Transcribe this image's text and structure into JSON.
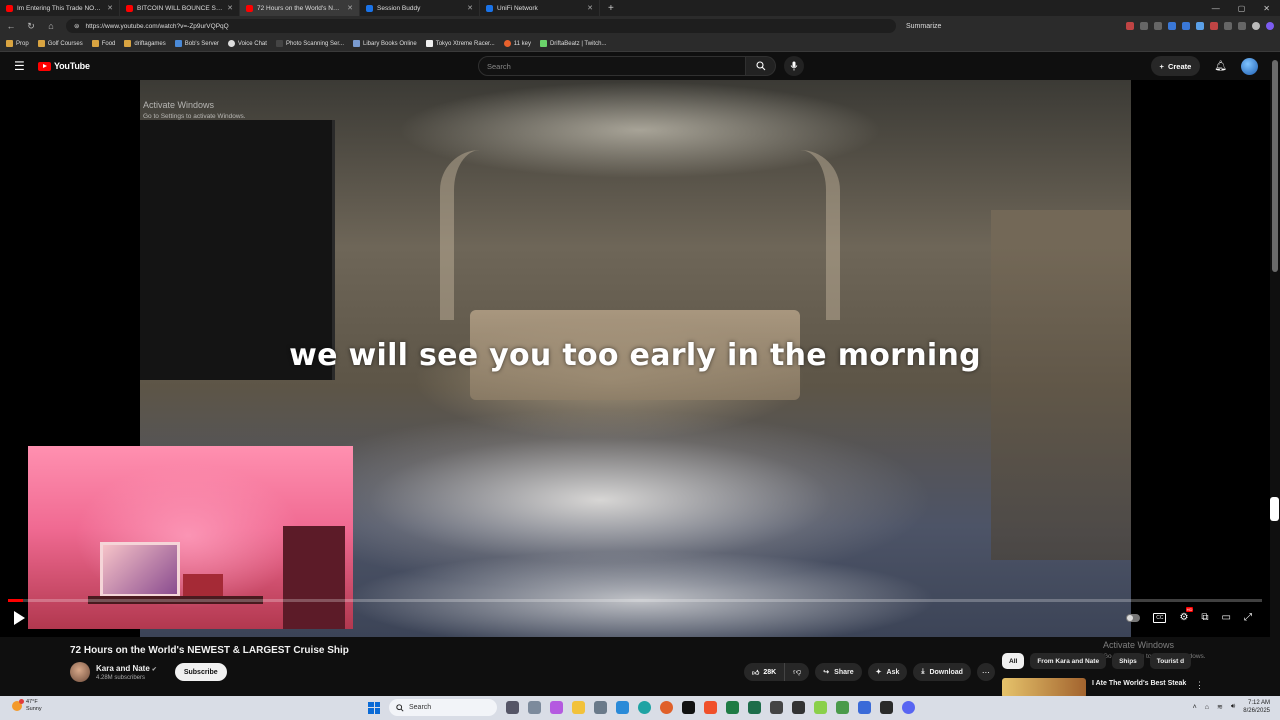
{
  "browser": {
    "tabs": [
      {
        "title": "Im Entering This Trade NOW - ",
        "color": "#ff0000",
        "active": false
      },
      {
        "title": "BITCOIN WILL BOUNCE SOON AF",
        "color": "#ff0000",
        "active": false
      },
      {
        "title": "72 Hours on the World's NEWEST",
        "color": "#ff0000",
        "active": true
      },
      {
        "title": "Session Buddy",
        "color": "#1a73e8",
        "active": false
      },
      {
        "title": "UniFi Network",
        "color": "#1a73e8",
        "active": false
      }
    ],
    "url": "https://www.youtube.com/watch?v=-Zp9urVQPqQ",
    "summarize_label": "Summarize",
    "bookmarks": [
      "Prop",
      "Golf Courses",
      "Food",
      "driftagames",
      "Bob's Server",
      "Voice Chat",
      "Photo Scanning Ser...",
      "Libary Books Online",
      "Tokyo Xtreme Racer...",
      "11 key",
      "DriftaBeatz | Twitch..."
    ]
  },
  "header": {
    "logo_text": "YouTube",
    "search_placeholder": "Search",
    "create_label": "Create"
  },
  "player": {
    "caption": "we will see you too early in the morning",
    "progress": 0.012,
    "watermark_title": "Activate Windows",
    "watermark_sub": "Go to Settings to activate Windows."
  },
  "video": {
    "title": "72 Hours on the World's NEWEST & LARGEST Cruise Ship",
    "channel": "Kara and Nate",
    "subscribers": "4.28M subscribers",
    "subscribe_label": "Subscribe",
    "likes": "28K",
    "share_label": "Share",
    "ask_label": "Ask",
    "download_label": "Download"
  },
  "sidebar": {
    "chips": [
      {
        "label": "All",
        "active": true
      },
      {
        "label": "From Kara and Nate",
        "active": false
      },
      {
        "label": "Ships",
        "active": false
      },
      {
        "label": "Tourist d",
        "active": false
      }
    ],
    "recommendation_title": "I Ate The World's Best Steak",
    "activate_title": "Activate Windows",
    "activate_sub": "Go to Settings to activate Windows."
  },
  "taskbar": {
    "weather_temp": "47°F",
    "weather_desc": "Sunny",
    "search_label": "Search",
    "time": "7:12 AM",
    "date": "8/26/2025"
  }
}
